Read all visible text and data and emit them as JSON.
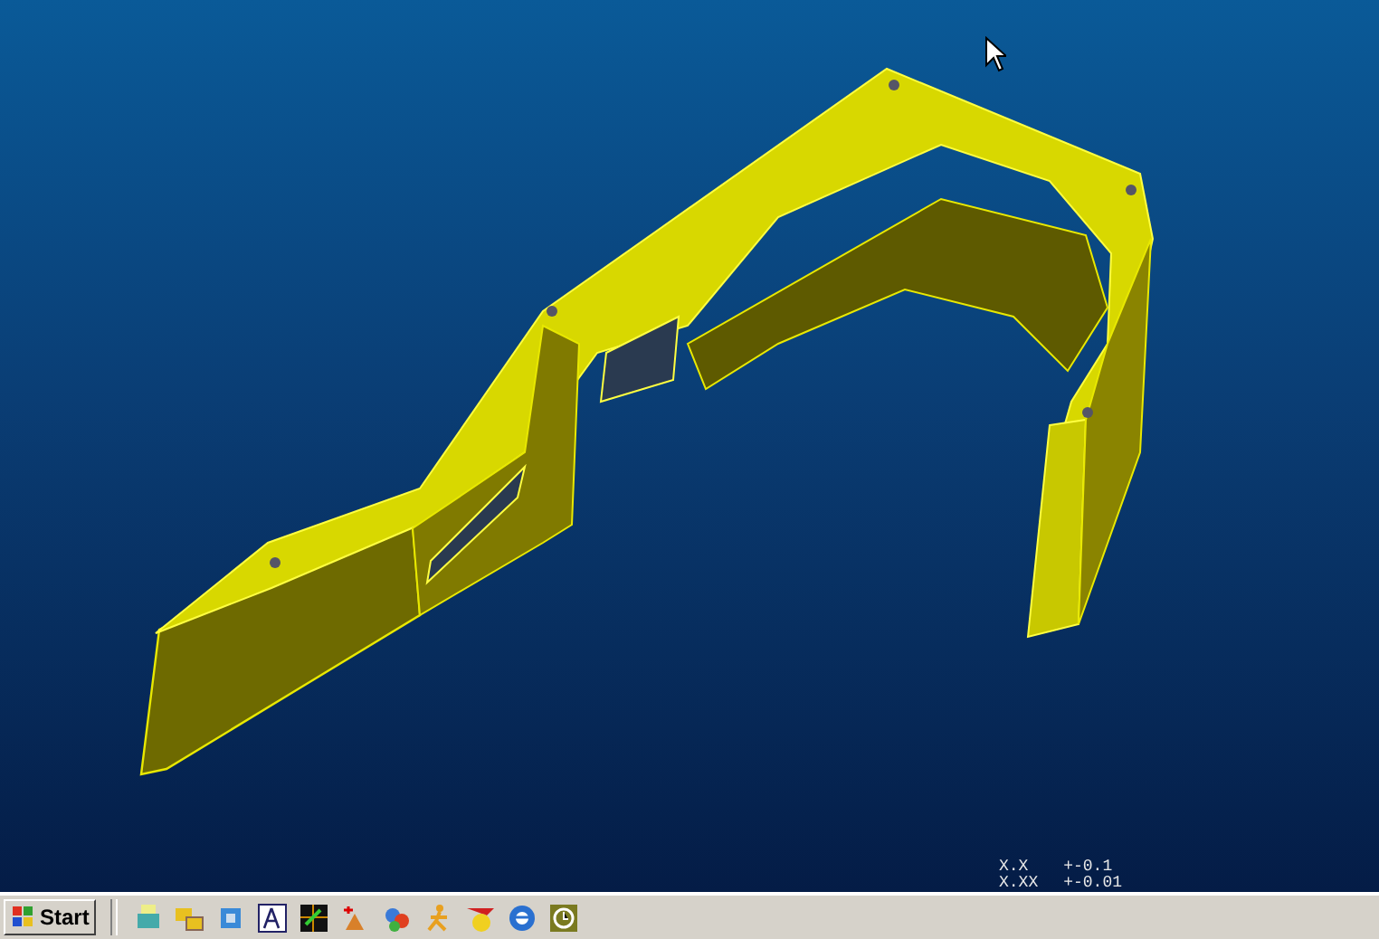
{
  "viewport": {
    "tolerances": [
      {
        "format": "X.X",
        "value": "+-0.1"
      },
      {
        "format": "X.XX",
        "value": "+-0.01"
      }
    ]
  },
  "taskbar": {
    "start_label": "Start"
  }
}
